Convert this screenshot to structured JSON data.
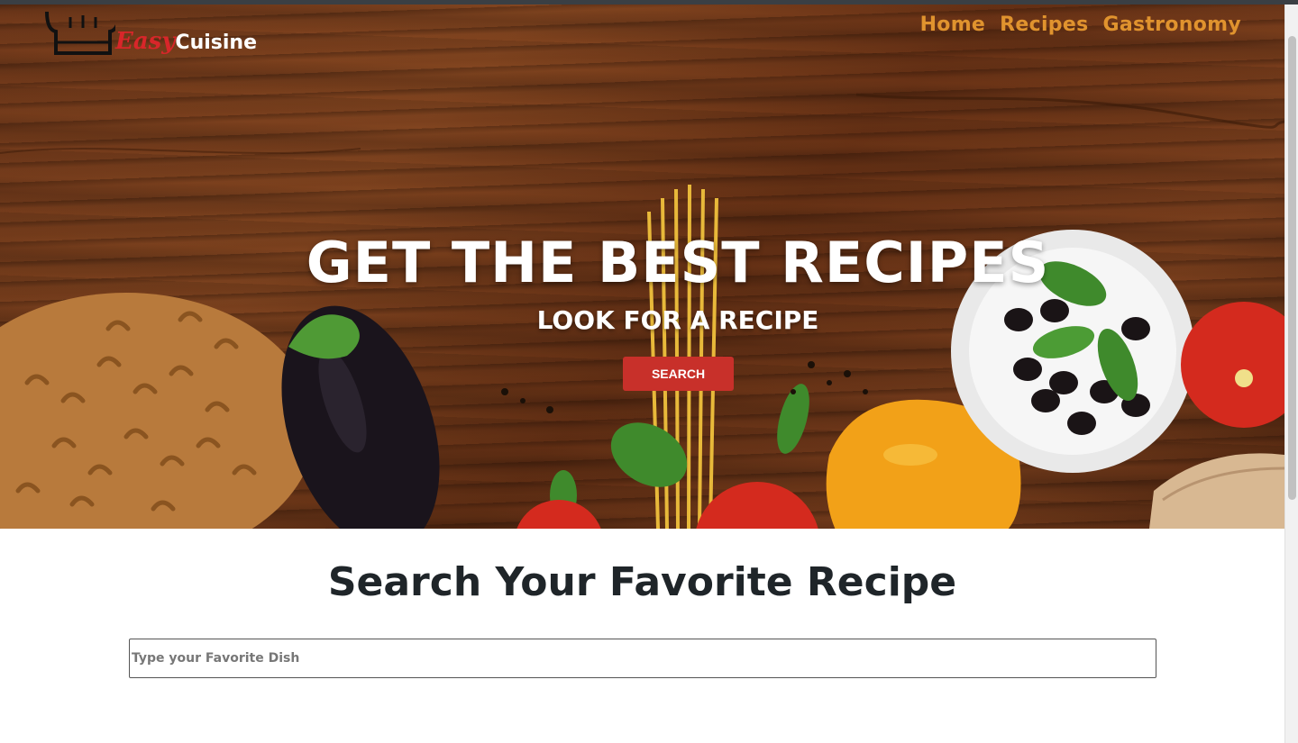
{
  "header": {
    "logo_easy": "Easy",
    "logo_cuisine": "Cuisine",
    "nav": [
      {
        "label": "Home"
      },
      {
        "label": "Recipes"
      },
      {
        "label": "Gastronomy"
      }
    ]
  },
  "hero": {
    "title": "GET THE BEST RECIPES",
    "subtitle": "LOOK FOR A RECIPE",
    "button_label": "SEARCH"
  },
  "search": {
    "title": "Search Your Favorite Recipe",
    "placeholder": "Type your Favorite Dish",
    "value": ""
  },
  "colors": {
    "nav_link": "#e0932e",
    "accent_red": "#c8302a",
    "logo_red": "#d8262a",
    "heading_dark": "#1f2529"
  },
  "icons": [
    "chef-hat-icon"
  ]
}
